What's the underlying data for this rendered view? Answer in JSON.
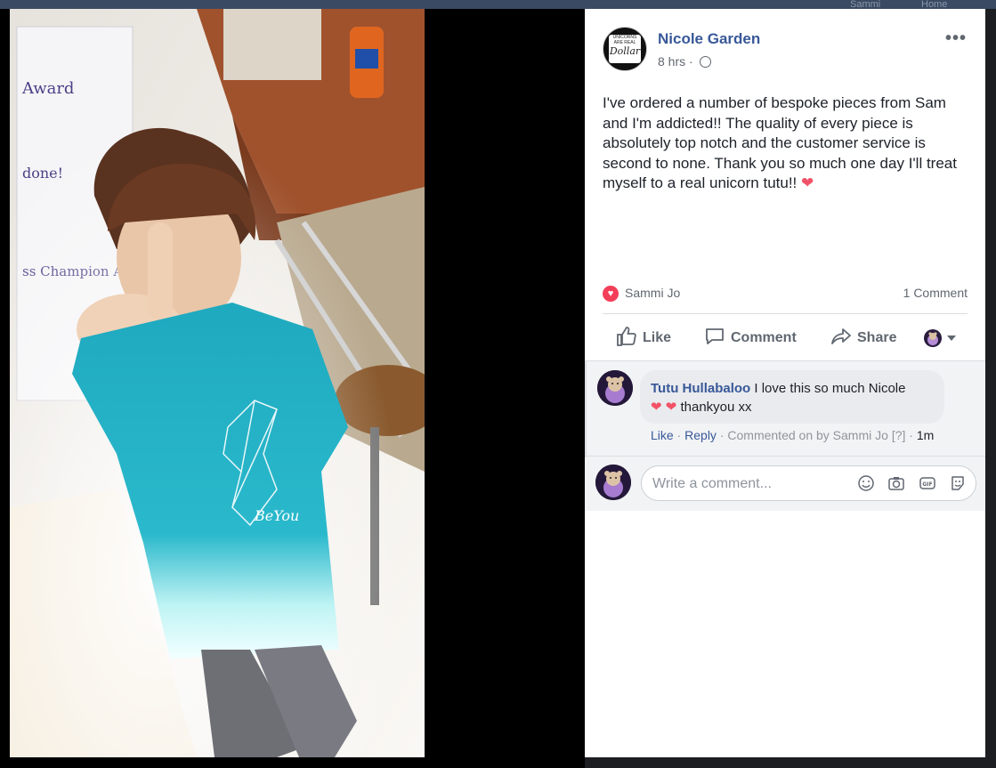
{
  "topbar": {
    "ghost_items": [
      "Sammi",
      "Home"
    ]
  },
  "post": {
    "author": "Nicole Garden",
    "avatar_text": {
      "line1": "UNICORNS ARE REAL",
      "line2": "Dollar"
    },
    "time": "8 hrs",
    "separator": "·",
    "text": "I've ordered a number of bespoke pieces from Sam and I'm addicted!! The quality of every piece is absolutely top notch and the customer service is second to none. Thank you so much one day I'll treat myself to a real unicorn tutu!!",
    "text_emoji": "❤",
    "more_label": "•••"
  },
  "reactions": {
    "icon_glyph": "♥",
    "names": "Sammi Jo",
    "comment_count": "1 Comment"
  },
  "actions": {
    "like": "Like",
    "comment": "Comment",
    "share": "Share"
  },
  "comment": {
    "author": "Tutu Hullabaloo",
    "text_line1": "I love this so much Nicole",
    "emoji": "❤ ❤",
    "text_line2": "thankyou xx",
    "like": "Like",
    "reply": "Reply",
    "commented_on": "Commented on by Sammi Jo",
    "help": "[?]",
    "sep": "·",
    "time": "1m"
  },
  "composer": {
    "placeholder": "Write a comment..."
  },
  "colors": {
    "link_blue": "#385898",
    "love_red": "#f33e58",
    "text": "#1d2129",
    "muted": "#606770"
  },
  "icons": [
    "globe-icon",
    "more-icon",
    "love-icon",
    "like-icon",
    "comment-icon",
    "share-icon",
    "emoji-icon",
    "camera-icon",
    "gif-icon",
    "sticker-icon",
    "caret-down-icon"
  ]
}
